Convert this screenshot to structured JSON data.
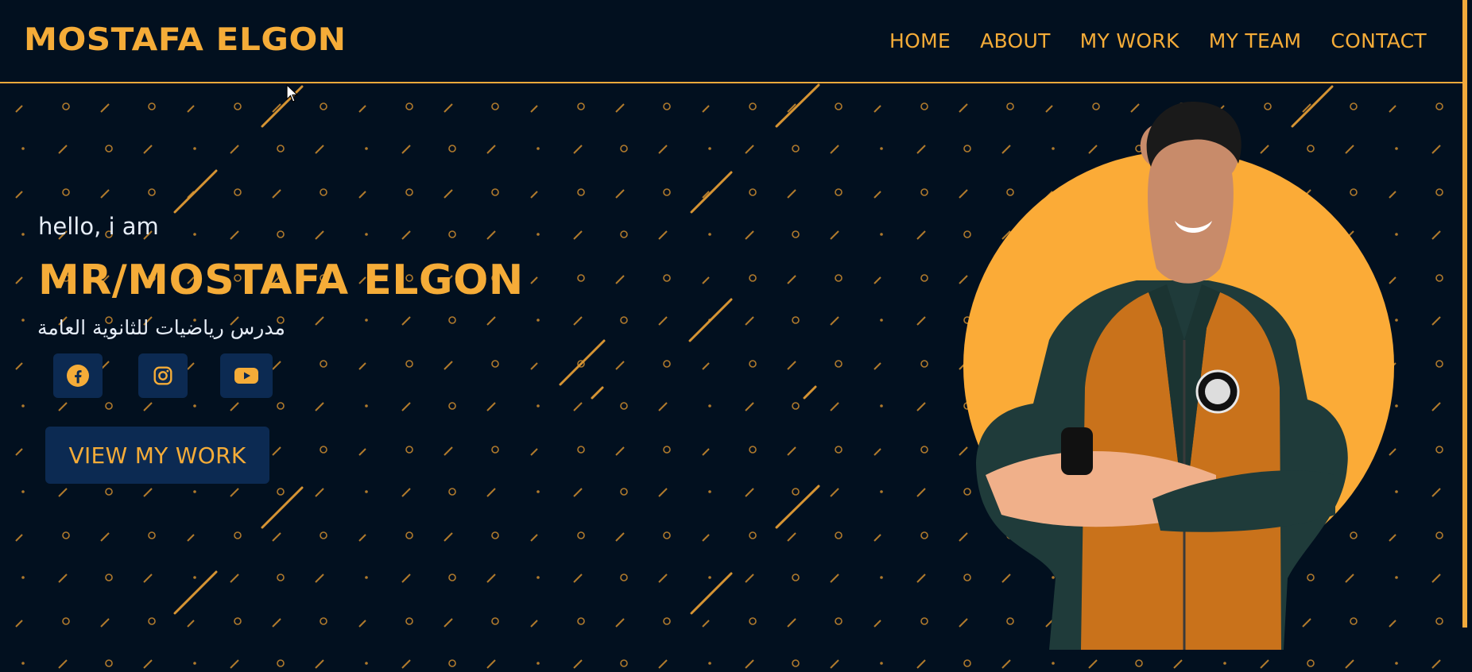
{
  "header": {
    "logo": "MOSTAFA ELGON",
    "nav": [
      {
        "label": "HOME"
      },
      {
        "label": "ABOUT"
      },
      {
        "label": "MY WORK"
      },
      {
        "label": "MY TEAM"
      },
      {
        "label": "CONTACT"
      }
    ]
  },
  "hero": {
    "greeting": "hello, i am",
    "name": "MR/MOSTAFA ELGON",
    "subtitle": "مدرس رياضيات للثانوية العامة",
    "social": [
      {
        "icon": "facebook-icon"
      },
      {
        "icon": "instagram-icon"
      },
      {
        "icon": "youtube-icon"
      }
    ],
    "cta_label": "VIEW MY WORK"
  },
  "colors": {
    "background": "#02101f",
    "accent": "#f5ac38",
    "button_bg": "#0c2a52",
    "text_light": "#e6edf7"
  }
}
